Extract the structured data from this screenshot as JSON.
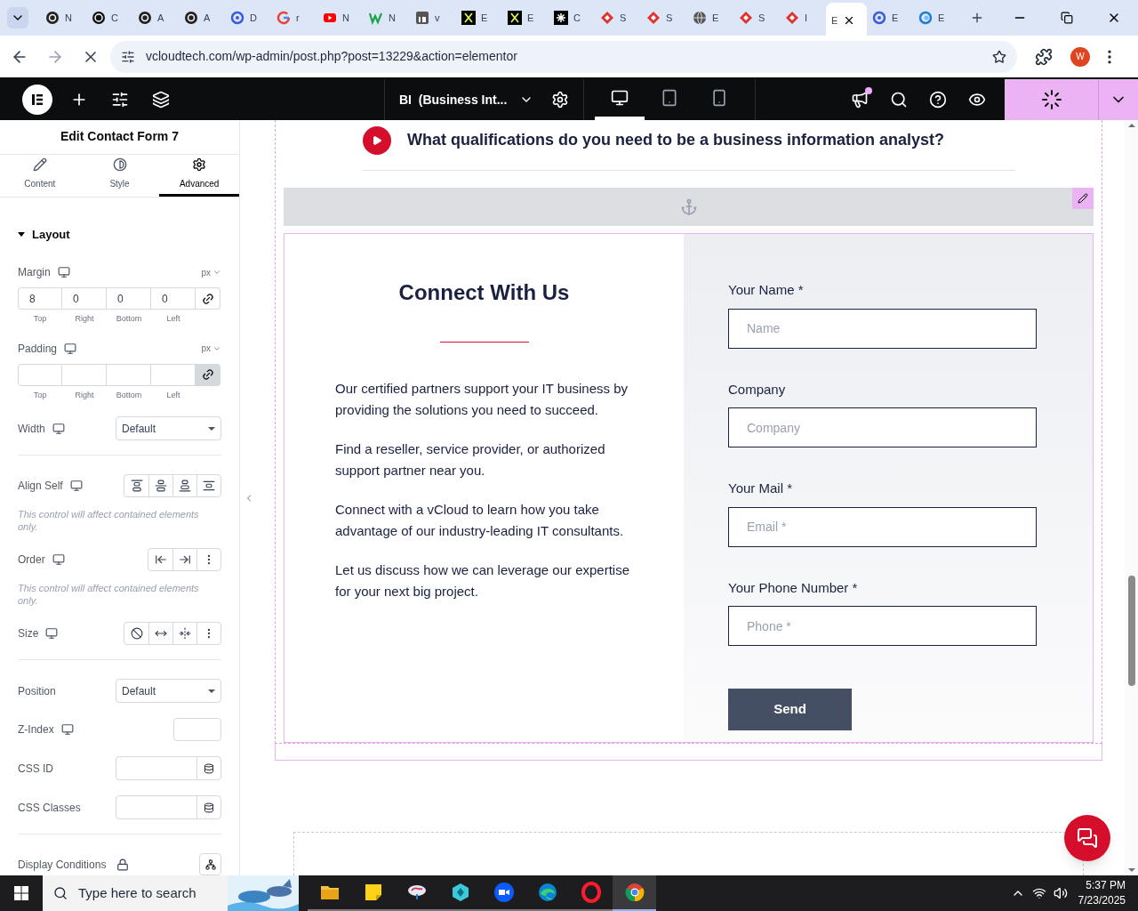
{
  "browser": {
    "tabs": [
      {
        "label": "N",
        "kind": "openai",
        "selected": false
      },
      {
        "label": "C",
        "kind": "dark-circle",
        "selected": false
      },
      {
        "label": "A",
        "kind": "openai",
        "selected": false
      },
      {
        "label": "A",
        "kind": "openai",
        "selected": false
      },
      {
        "label": "D",
        "kind": "blue-swirl",
        "selected": false
      },
      {
        "label": "r",
        "kind": "google",
        "selected": false
      },
      {
        "label": "N",
        "kind": "youtube",
        "selected": false
      },
      {
        "label": "N",
        "kind": "w-logo",
        "selected": false
      },
      {
        "label": "v",
        "kind": "linkedin",
        "selected": false
      },
      {
        "label": "E",
        "kind": "x-logo",
        "selected": false
      },
      {
        "label": "E",
        "kind": "x-logo",
        "selected": false
      },
      {
        "label": "C",
        "kind": "asterisk",
        "selected": false
      },
      {
        "label": "S",
        "kind": "red-diamond",
        "selected": false
      },
      {
        "label": "S",
        "kind": "red-diamond",
        "selected": false
      },
      {
        "label": "E",
        "kind": "globe",
        "selected": false
      },
      {
        "label": "S",
        "kind": "red-diamond",
        "selected": false
      },
      {
        "label": "I",
        "kind": "red-diamond",
        "selected": false
      },
      {
        "label": "E",
        "kind": "none",
        "selected": true
      },
      {
        "label": "E",
        "kind": "blue-swirl",
        "selected": false
      },
      {
        "label": "E",
        "kind": "blue-ring",
        "selected": false
      }
    ],
    "url": "vcloudtech.com/wp-admin/post.php?post=13229&action=elementor",
    "profile": "W"
  },
  "editor_bar": {
    "page_title": "BI  (Business Int...",
    "devices": [
      {
        "kind": "desktop",
        "selected": true
      },
      {
        "kind": "tablet",
        "selected": false
      },
      {
        "kind": "mobile",
        "selected": false
      }
    ],
    "notification": true
  },
  "panel": {
    "title": "Edit Contact Form 7",
    "tabs": [
      {
        "label": "Content",
        "kind": "pencil",
        "selected": false
      },
      {
        "label": "Style",
        "kind": "contrast",
        "selected": false
      },
      {
        "label": "Advanced",
        "kind": "gear",
        "selected": true
      }
    ],
    "section": {
      "title": "Layout",
      "expanded": true
    },
    "controls": [
      {
        "kind": "dimensions",
        "label": "Margin",
        "responsive": true,
        "unit": "px",
        "values": [
          "8",
          "0",
          "0",
          "0"
        ],
        "sides": [
          "Top",
          "Right",
          "Bottom",
          "Left"
        ],
        "linked": false,
        "divider_after": false
      },
      {
        "kind": "dimensions",
        "label": "Padding",
        "responsive": true,
        "unit": "px",
        "sides": [
          "Top",
          "Right",
          "Bottom",
          "Left"
        ],
        "linked": true,
        "divider_after": false
      },
      {
        "kind": "select",
        "label": "Width",
        "responsive": true,
        "value": "Default",
        "divider_after": true
      },
      {
        "kind": "buttons",
        "label": "Align Self",
        "responsive": true,
        "buttons": [
          {
            "kind": "align-start"
          },
          {
            "kind": "align-center"
          },
          {
            "kind": "align-end"
          },
          {
            "kind": "stretch"
          }
        ],
        "note": "This control will affect contained elements only.",
        "divider_after": false
      },
      {
        "kind": "buttons",
        "label": "Order",
        "responsive": true,
        "buttons": [
          {
            "kind": "start"
          },
          {
            "kind": "end"
          },
          {
            "kind": "more"
          }
        ],
        "note": "This control will affect contained elements only.",
        "divider_after": false
      },
      {
        "kind": "buttons",
        "label": "Size",
        "responsive": true,
        "buttons": [
          {
            "kind": "none"
          },
          {
            "kind": "grow"
          },
          {
            "kind": "shrink"
          },
          {
            "kind": "more"
          }
        ],
        "divider_after": true
      },
      {
        "kind": "select",
        "label": "Position",
        "responsive": false,
        "value": "Default",
        "divider_after": false
      },
      {
        "kind": "input",
        "label": "Z-Index",
        "responsive": true,
        "divider_after": false
      },
      {
        "kind": "input-icon",
        "label": "CSS ID",
        "responsive": false,
        "divider_after": false
      },
      {
        "kind": "input-icon",
        "label": "CSS Classes",
        "responsive": false,
        "divider_after": true
      },
      {
        "kind": "conditions",
        "label": "Display Conditions",
        "responsive": false,
        "divider_after": false
      }
    ]
  },
  "canvas": {
    "question": "What qualifications do you need to be a business information analyst?",
    "contact": {
      "heading": "Connect With Us",
      "paragraphs": [
        "Our certified partners support your IT business by providing the solutions you need to succeed.",
        "Find a reseller, service provider, or authorized support partner near you.",
        "Connect with a vCloud to learn how you take advantage of our industry-leading IT consultants.",
        "Let us discuss how we can leverage our expertise for your next big project."
      ],
      "fields": [
        {
          "label": "Your Name *",
          "placeholder": "Name"
        },
        {
          "label": "Company",
          "placeholder": "Company"
        },
        {
          "label": "Your Mail *",
          "placeholder": "Email *"
        },
        {
          "label": "Your Phone Number *",
          "placeholder": "Phone *"
        }
      ],
      "button": "Send"
    }
  },
  "taskbar": {
    "search_placeholder": "Type here to search",
    "apps": [
      {
        "kind": "folder",
        "selected": false
      },
      {
        "kind": "notes",
        "selected": false
      },
      {
        "kind": "bird",
        "selected": false
      },
      {
        "kind": "hexagon",
        "selected": false
      },
      {
        "kind": "zoom",
        "selected": false
      },
      {
        "kind": "edge",
        "selected": false
      },
      {
        "kind": "opera",
        "selected": false
      },
      {
        "kind": "chrome",
        "selected": true
      }
    ],
    "time": "5:37 PM",
    "date": "7/23/2025"
  }
}
